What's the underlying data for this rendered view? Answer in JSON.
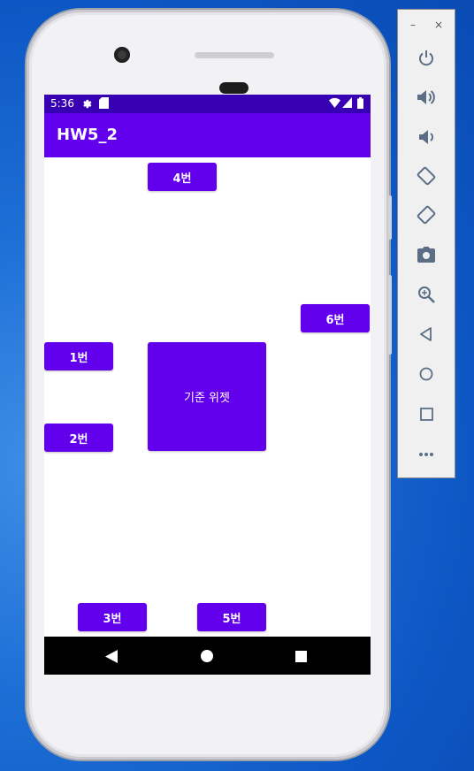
{
  "status_bar": {
    "time": "5:36"
  },
  "app_bar": {
    "title": "HW5_2"
  },
  "buttons": {
    "b1": "1번",
    "b2": "2번",
    "b3": "3번",
    "b4": "4번",
    "b5": "5번",
    "b6": "6번",
    "center": "기준 위젯"
  },
  "colors": {
    "primary": "#6200ee",
    "primary_dark": "#3700b3",
    "toolbar_icon": "#5b6e86"
  },
  "nav_icons": [
    "back-icon",
    "home-icon",
    "recents-icon"
  ],
  "toolbar": {
    "minimize_label": "–",
    "close_label": "×",
    "items": [
      "power-icon",
      "volume-up-icon",
      "volume-down-icon",
      "rotate-left-icon",
      "rotate-right-icon",
      "camera-icon",
      "zoom-icon",
      "back-icon",
      "home-icon",
      "overview-icon",
      "more-icon"
    ]
  }
}
